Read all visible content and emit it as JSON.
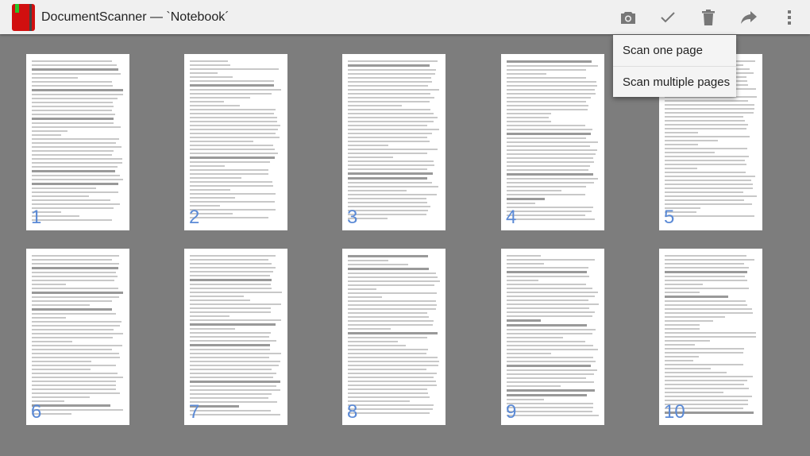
{
  "app": {
    "title": "DocumentScanner — `Notebook´"
  },
  "toolbar": {
    "actions": [
      {
        "name": "camera-icon",
        "label": "Scan"
      },
      {
        "name": "check-icon",
        "label": "Done"
      },
      {
        "name": "trash-icon",
        "label": "Delete"
      },
      {
        "name": "share-icon",
        "label": "Share"
      },
      {
        "name": "overflow-menu-icon",
        "label": "More"
      }
    ]
  },
  "menu": {
    "items": [
      "Scan one page",
      "Scan multiple pages"
    ]
  },
  "pages": [
    "1",
    "2",
    "3",
    "4",
    "5",
    "6",
    "7",
    "8",
    "9",
    "10"
  ],
  "colors": {
    "page_number": "#5b8ad6",
    "background": "#7d7d7d",
    "toolbar": "#f0f0f0"
  }
}
